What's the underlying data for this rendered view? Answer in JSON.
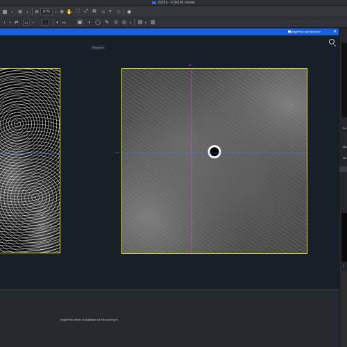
{
  "window": {
    "title": "ZEISS - FORUM Viewer"
  },
  "toolbar": {
    "zoom_value": "87%",
    "page_nav": "1/1",
    "opacity_value": "0%"
  },
  "tab": {
    "label": "AngioPlex and structure"
  },
  "viewer": {
    "layer_label": "Structure",
    "marker_top": "NT",
    "marker_side": "170"
  },
  "bottom": {
    "message": "AngioPlex Metrix unavailable for this scan type."
  },
  "right_strip": {
    "texts": [
      "De",
      "Ma",
      "Ne",
      "i"
    ]
  },
  "colors": {
    "tab_bar": "#1a5fe0",
    "image_border": "#e6e61e",
    "vertical_guide": "#dc46c8",
    "horizontal_guide": "#3c82e6"
  }
}
